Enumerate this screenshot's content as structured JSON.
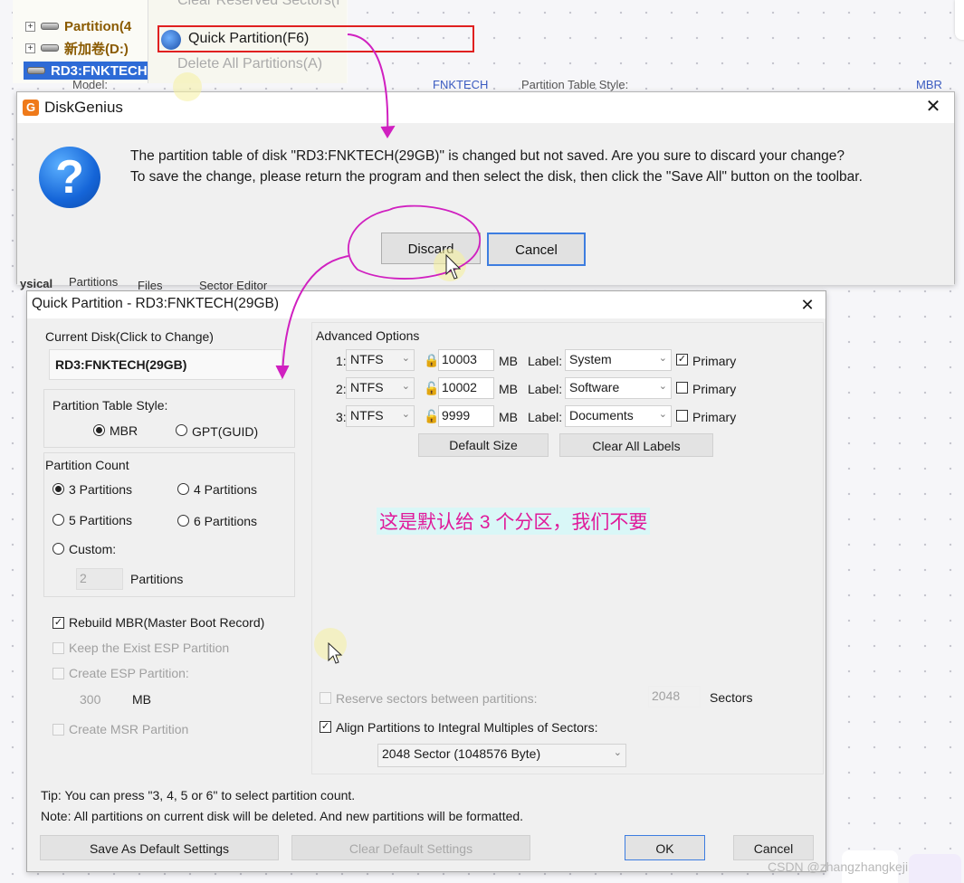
{
  "tree": {
    "items": [
      {
        "label": "Partition(4"
      },
      {
        "label": "新加卷(D:)"
      }
    ],
    "disk": "RD3:FNKTECH"
  },
  "context_menu": {
    "top_item": "Clear Reserved Sectors(I",
    "quick_partition": "Quick Partition(F6)",
    "delete_all": "Delete All Partitions(A)"
  },
  "bg_header": {
    "model": "Model:",
    "vendor": "FNKTECH",
    "pts": "Partition Table Style:",
    "style": "MBR"
  },
  "bg_tabs": {
    "tab1": "ysical",
    "tab2": "Partitions",
    "tab3": "Files",
    "tab4": "Sector Editor"
  },
  "dg_dialog": {
    "title": "DiskGenius",
    "message_line1": "The partition table of disk \"RD3:FNKTECH(29GB)\" is changed but not saved. Are you sure to discard your change?",
    "message_line2": "To save the change, please return the program and then select the disk, then click the \"Save All\" button on the toolbar.",
    "discard_label": "Discard",
    "cancel_label": "Cancel",
    "close_glyph": "✕"
  },
  "qp_dialog": {
    "title": "Quick Partition - RD3:FNKTECH(29GB)",
    "close_glyph": "✕",
    "current_disk_label": "Current Disk(Click to Change)",
    "current_disk_value": "RD3:FNKTECH(29GB)",
    "pts_label": "Partition Table Style:",
    "mbr": "MBR",
    "gpt": "GPT(GUID)",
    "partition_count_label": "Partition Count",
    "count_3": "3 Partitions",
    "count_4": "4 Partitions",
    "count_5": "5 Partitions",
    "count_6": "6 Partitions",
    "custom": "Custom:",
    "custom_value": "2",
    "partitions_suffix": "Partitions",
    "rebuild_mbr": "Rebuild MBR(Master Boot Record)",
    "keep_esp": "Keep the Exist ESP Partition",
    "create_esp": "Create ESP Partition:",
    "esp_size": "300",
    "esp_unit": "MB",
    "create_msr": "Create MSR Partition",
    "advanced_options": "Advanced Options",
    "partitions": [
      {
        "index": "1:",
        "fs": "NTFS",
        "size": "10003",
        "unit": "MB",
        "label_prefix": "Label:",
        "label": "System",
        "primary": "Primary",
        "primary_checked": true
      },
      {
        "index": "2:",
        "fs": "NTFS",
        "size": "10002",
        "unit": "MB",
        "label_prefix": "Label:",
        "label": "Software",
        "primary": "Primary",
        "primary_checked": false
      },
      {
        "index": "3:",
        "fs": "NTFS",
        "size": "9999",
        "unit": "MB",
        "label_prefix": "Label:",
        "label": "Documents",
        "primary": "Primary",
        "primary_checked": false
      }
    ],
    "default_size_btn": "Default Size",
    "clear_labels_btn": "Clear All Labels",
    "reserve_sectors": "Reserve sectors between partitions:",
    "reserve_value": "2048",
    "reserve_unit": "Sectors",
    "align_label": "Align Partitions to Integral Multiples of Sectors:",
    "align_value": "2048 Sector (1048576 Byte)",
    "tip": "Tip:  You can press \"3, 4, 5 or 6\" to select partition count.",
    "note": "Note: All partitions on current disk will be deleted. And new partitions will be formatted.",
    "save_default_btn": "Save As Default Settings",
    "clear_default_btn": "Clear Default Settings",
    "ok_btn": "OK",
    "cancel_btn": "Cancel"
  },
  "annotation_cn": "这是默认给 3 个分区，我们不要",
  "watermark": "CSDN @zhangzhangkeji",
  "colors": {
    "annotation": "#d020c0",
    "highlight_box": "#e02020",
    "selection": "#2e6bd6",
    "accent_button": "#3d7de0"
  },
  "icons": [
    "expander-icon",
    "drive-icon",
    "quick-partition-icon",
    "diskgenius-logo-icon",
    "question-icon",
    "close-icon",
    "lock-icon",
    "dropdown-arrow-icon",
    "cursor-icon"
  ]
}
